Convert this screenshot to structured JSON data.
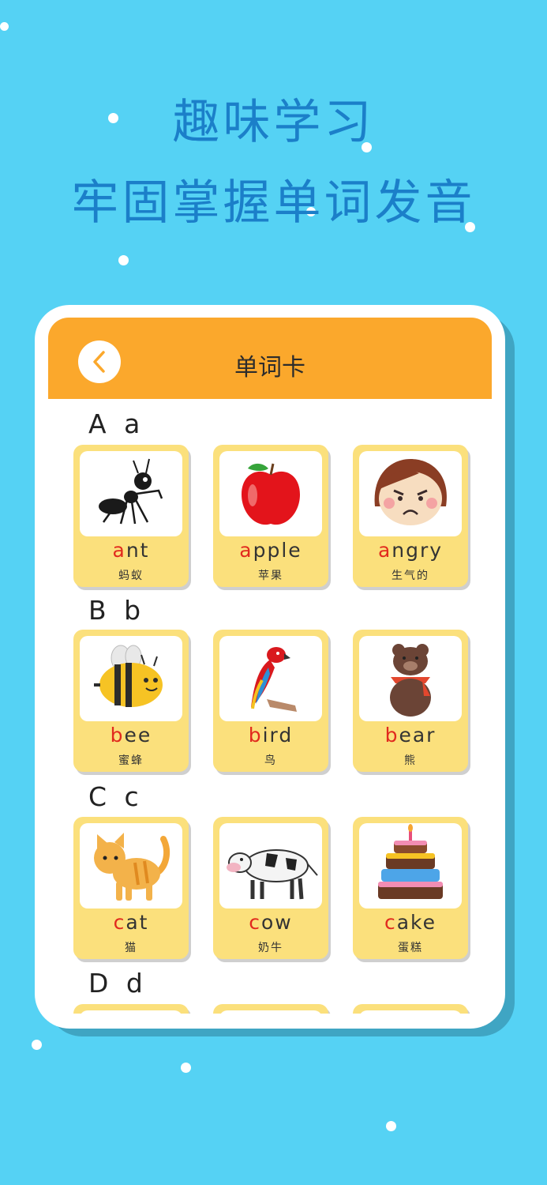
{
  "headline": {
    "line1": "趣味学习",
    "line2": "牢固掌握单词发音"
  },
  "header": {
    "title": "单词卡",
    "back_icon": "chevron-left-icon"
  },
  "colors": {
    "background": "#55d2f4",
    "header": "#fba82c",
    "card": "#fbe07c",
    "headline": "#1b7fc9",
    "first_letter": "#e12a1e"
  },
  "sections": [
    {
      "letter": "A a",
      "cards": [
        {
          "first": "a",
          "rest": "nt",
          "cn": "蚂蚁",
          "icon": "ant-icon"
        },
        {
          "first": "a",
          "rest": "pple",
          "cn": "苹果",
          "icon": "apple-icon"
        },
        {
          "first": "a",
          "rest": "ngry",
          "cn": "生气的",
          "icon": "angry-face-icon"
        }
      ]
    },
    {
      "letter": "B b",
      "cards": [
        {
          "first": "b",
          "rest": "ee",
          "cn": "蜜蜂",
          "icon": "bee-icon"
        },
        {
          "first": "b",
          "rest": "ird",
          "cn": "鸟",
          "icon": "bird-icon"
        },
        {
          "first": "b",
          "rest": "ear",
          "cn": "熊",
          "icon": "bear-icon"
        }
      ]
    },
    {
      "letter": "C c",
      "cards": [
        {
          "first": "c",
          "rest": "at",
          "cn": "猫",
          "icon": "cat-icon"
        },
        {
          "first": "c",
          "rest": "ow",
          "cn": "奶牛",
          "icon": "cow-icon"
        },
        {
          "first": "c",
          "rest": "ake",
          "cn": "蛋糕",
          "icon": "cake-icon"
        }
      ]
    },
    {
      "letter": "D d"
    }
  ]
}
